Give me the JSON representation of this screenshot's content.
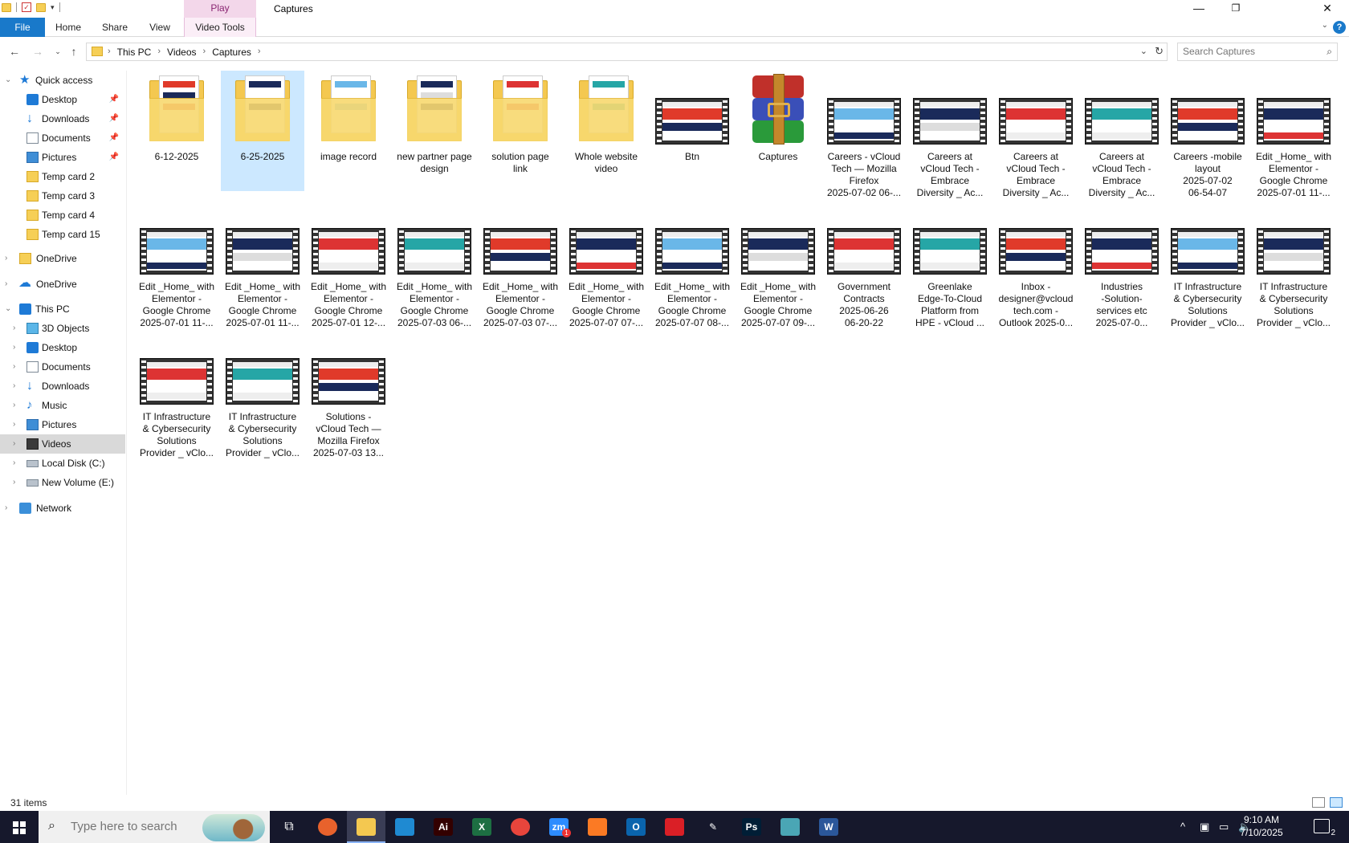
{
  "window": {
    "title": "Captures",
    "context_tab": "Play",
    "controls": {
      "minimize": "—",
      "restore": "❐",
      "close": "✕"
    }
  },
  "ribbon": {
    "tabs": [
      "File",
      "Home",
      "Share",
      "View",
      "Video Tools"
    ],
    "help": "?"
  },
  "address": {
    "crumbs": [
      "This PC",
      "Videos",
      "Captures"
    ],
    "search_placeholder": "Search Captures"
  },
  "nav": {
    "quick_access": "Quick access",
    "quick_items": [
      "Desktop",
      "Downloads",
      "Documents",
      "Pictures",
      "Temp  card 2",
      "Temp  card 3",
      "Temp  card 4",
      "Temp  card 15"
    ],
    "onedrive1": "OneDrive",
    "onedrive2": "OneDrive",
    "this_pc": "This PC",
    "pc_items": [
      "3D Objects",
      "Desktop",
      "Documents",
      "Downloads",
      "Music",
      "Pictures",
      "Videos",
      "Local Disk (C:)",
      "New Volume (E:)"
    ],
    "network": "Network"
  },
  "files": [
    {
      "name": "6-12-2025",
      "kind": "folder"
    },
    {
      "name": "6-25-2025",
      "kind": "folder"
    },
    {
      "name": "image record",
      "kind": "folder"
    },
    {
      "name": "new partner page\ndesign",
      "kind": "folder"
    },
    {
      "name": "solution page\nlink",
      "kind": "folder"
    },
    {
      "name": "Whole website\nvideo",
      "kind": "folder"
    },
    {
      "name": "Btn",
      "kind": "video"
    },
    {
      "name": "Captures",
      "kind": "archive"
    },
    {
      "name": "Careers - vCloud\nTech — Mozilla\nFirefox\n2025-07-02 06-...",
      "kind": "video"
    },
    {
      "name": "Careers at\nvCloud Tech -\nEmbrace\nDiversity _ Ac...",
      "kind": "video"
    },
    {
      "name": "Careers at\nvCloud Tech -\nEmbrace\nDiversity _ Ac...",
      "kind": "video"
    },
    {
      "name": "Careers at\nvCloud Tech -\nEmbrace\nDiversity _ Ac...",
      "kind": "video"
    },
    {
      "name": "Careers -mobile\nlayout\n2025-07-02\n06-54-07",
      "kind": "video"
    },
    {
      "name": "Edit _Home_ with\nElementor -\nGoogle Chrome\n2025-07-01 11-...",
      "kind": "video"
    },
    {
      "name": "Edit _Home_ with\nElementor -\nGoogle Chrome\n2025-07-01 11-...",
      "kind": "video"
    },
    {
      "name": "Edit _Home_ with\nElementor -\nGoogle Chrome\n2025-07-01 11-...",
      "kind": "video"
    },
    {
      "name": "Edit _Home_ with\nElementor -\nGoogle Chrome\n2025-07-01 12-...",
      "kind": "video"
    },
    {
      "name": "Edit _Home_ with\nElementor -\nGoogle Chrome\n2025-07-03 06-...",
      "kind": "video"
    },
    {
      "name": "Edit _Home_ with\nElementor -\nGoogle Chrome\n2025-07-03 07-...",
      "kind": "video"
    },
    {
      "name": "Edit _Home_ with\nElementor -\nGoogle Chrome\n2025-07-07 07-...",
      "kind": "video"
    },
    {
      "name": "Edit _Home_ with\nElementor -\nGoogle Chrome\n2025-07-07 08-...",
      "kind": "video"
    },
    {
      "name": "Edit _Home_ with\nElementor -\nGoogle Chrome\n2025-07-07 09-...",
      "kind": "video"
    },
    {
      "name": "Government\nContracts\n2025-06-26\n06-20-22",
      "kind": "video"
    },
    {
      "name": "Greenlake\nEdge-To-Cloud\nPlatform from\nHPE - vCloud ...",
      "kind": "video"
    },
    {
      "name": "Inbox -\ndesigner@vcloud\ntech.com -\nOutlook 2025-0...",
      "kind": "video"
    },
    {
      "name": "Industries\n-Solution-\nservices etc\n2025-07-0...",
      "kind": "video"
    },
    {
      "name": "IT Infrastructure\n& Cybersecurity\nSolutions\nProvider _ vClo...",
      "kind": "video"
    },
    {
      "name": "IT Infrastructure\n& Cybersecurity\nSolutions\nProvider _ vClo...",
      "kind": "video"
    },
    {
      "name": "IT Infrastructure\n& Cybersecurity\nSolutions\nProvider _ vClo...",
      "kind": "video"
    },
    {
      "name": "IT Infrastructure\n& Cybersecurity\nSolutions\nProvider _ vClo...",
      "kind": "video"
    },
    {
      "name": "Solutions -\nvCloud Tech —\nMozilla Firefox\n2025-07-03 13...",
      "kind": "video"
    }
  ],
  "status": {
    "item_count": "31 items"
  },
  "taskbar": {
    "search_placeholder": "Type here to search",
    "apps": [
      {
        "icon": "firefox-icon",
        "glyph": "",
        "color": "#e8622c"
      },
      {
        "icon": "file-explorer-icon",
        "glyph": "",
        "color": "#f4c850"
      },
      {
        "icon": "vscode-icon",
        "glyph": "",
        "color": "#1f8ad2"
      },
      {
        "icon": "illustrator-icon",
        "glyph": "Ai",
        "color": "#330000"
      },
      {
        "icon": "excel-icon",
        "glyph": "X",
        "color": "#1d6f42"
      },
      {
        "icon": "chrome-icon",
        "glyph": "",
        "color": "#e8453c"
      },
      {
        "icon": "zoom-icon",
        "glyph": "zm",
        "color": "#2d8cff"
      },
      {
        "icon": "xampp-icon",
        "glyph": "",
        "color": "#fb7a24"
      },
      {
        "icon": "outlook-icon",
        "glyph": "O",
        "color": "#0a64ad"
      },
      {
        "icon": "creative-cloud-icon",
        "glyph": "",
        "color": "#da1f26"
      },
      {
        "icon": "pen-icon",
        "glyph": "✎",
        "color": "#16182c"
      },
      {
        "icon": "photoshop-icon",
        "glyph": "Ps",
        "color": "#001e36"
      },
      {
        "icon": "app-icon",
        "glyph": "",
        "color": "#4aa6b5"
      },
      {
        "icon": "word-icon",
        "glyph": "W",
        "color": "#2b579a"
      }
    ],
    "zoom_badge": "1",
    "time": "9:10 AM",
    "date": "7/10/2025",
    "notification_count": "2"
  }
}
